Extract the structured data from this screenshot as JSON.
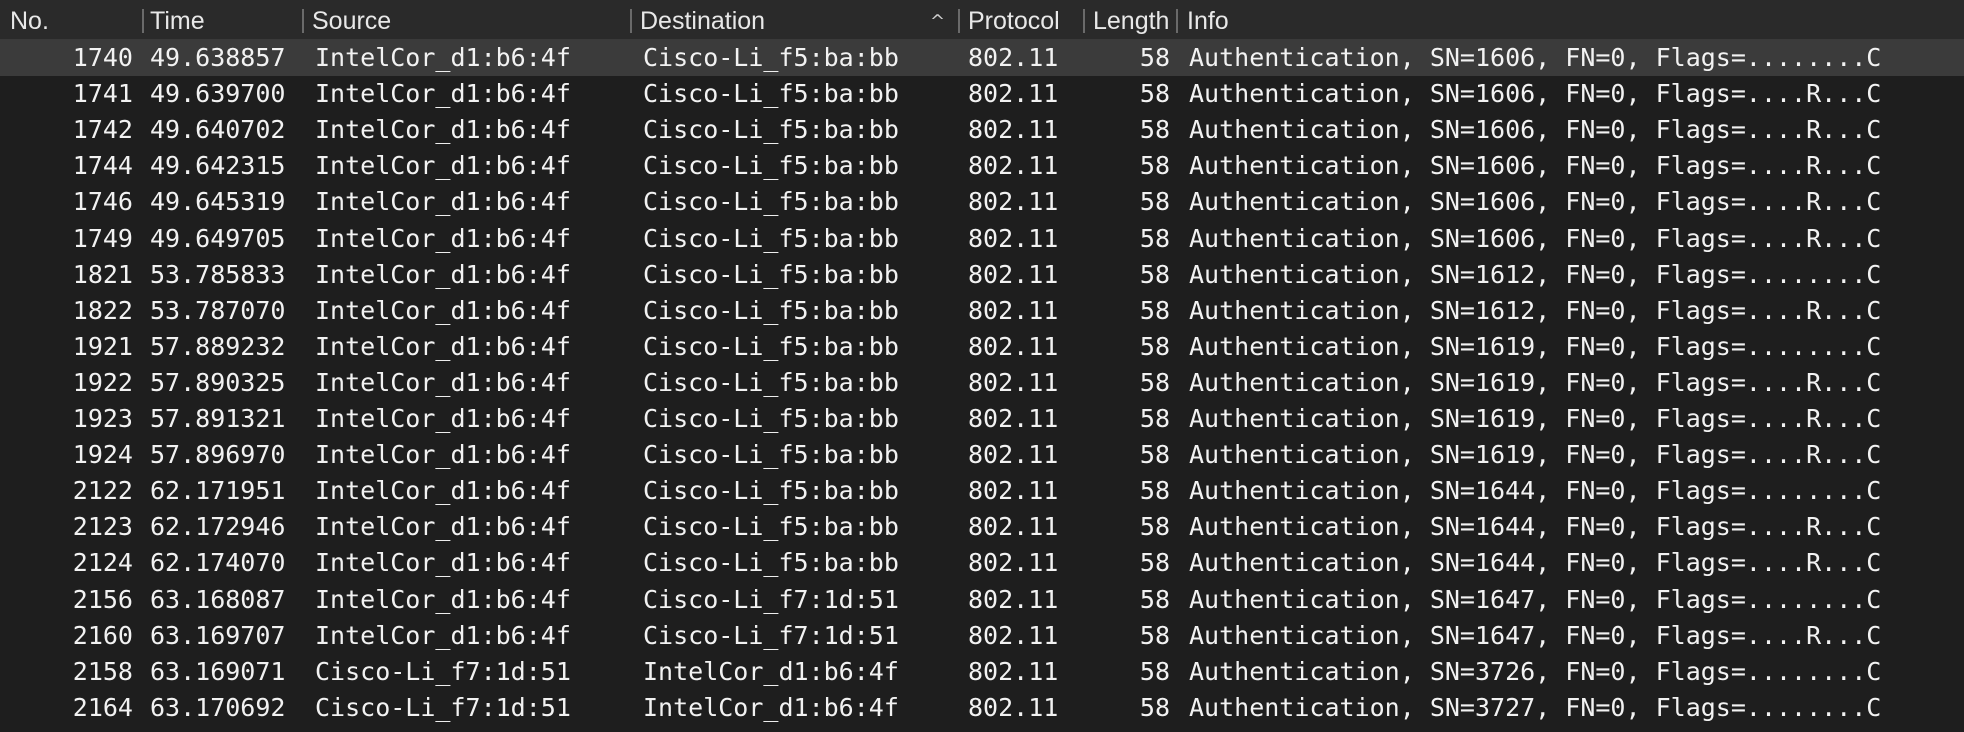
{
  "columns": {
    "no": "No.",
    "time": "Time",
    "source": "Source",
    "destination": "Destination",
    "protocol": "Protocol",
    "length": "Length",
    "info": "Info"
  },
  "sort_indicator": "^",
  "packets": [
    {
      "no": "1740",
      "time": "49.638857",
      "source": "IntelCor_d1:b6:4f",
      "destination": "Cisco-Li_f5:ba:bb",
      "protocol": "802.11",
      "length": "58",
      "info": "Authentication, SN=1606, FN=0, Flags=........C"
    },
    {
      "no": "1741",
      "time": "49.639700",
      "source": "IntelCor_d1:b6:4f",
      "destination": "Cisco-Li_f5:ba:bb",
      "protocol": "802.11",
      "length": "58",
      "info": "Authentication, SN=1606, FN=0, Flags=....R...C"
    },
    {
      "no": "1742",
      "time": "49.640702",
      "source": "IntelCor_d1:b6:4f",
      "destination": "Cisco-Li_f5:ba:bb",
      "protocol": "802.11",
      "length": "58",
      "info": "Authentication, SN=1606, FN=0, Flags=....R...C"
    },
    {
      "no": "1744",
      "time": "49.642315",
      "source": "IntelCor_d1:b6:4f",
      "destination": "Cisco-Li_f5:ba:bb",
      "protocol": "802.11",
      "length": "58",
      "info": "Authentication, SN=1606, FN=0, Flags=....R...C"
    },
    {
      "no": "1746",
      "time": "49.645319",
      "source": "IntelCor_d1:b6:4f",
      "destination": "Cisco-Li_f5:ba:bb",
      "protocol": "802.11",
      "length": "58",
      "info": "Authentication, SN=1606, FN=0, Flags=....R...C"
    },
    {
      "no": "1749",
      "time": "49.649705",
      "source": "IntelCor_d1:b6:4f",
      "destination": "Cisco-Li_f5:ba:bb",
      "protocol": "802.11",
      "length": "58",
      "info": "Authentication, SN=1606, FN=0, Flags=....R...C"
    },
    {
      "no": "1821",
      "time": "53.785833",
      "source": "IntelCor_d1:b6:4f",
      "destination": "Cisco-Li_f5:ba:bb",
      "protocol": "802.11",
      "length": "58",
      "info": "Authentication, SN=1612, FN=0, Flags=........C"
    },
    {
      "no": "1822",
      "time": "53.787070",
      "source": "IntelCor_d1:b6:4f",
      "destination": "Cisco-Li_f5:ba:bb",
      "protocol": "802.11",
      "length": "58",
      "info": "Authentication, SN=1612, FN=0, Flags=....R...C"
    },
    {
      "no": "1921",
      "time": "57.889232",
      "source": "IntelCor_d1:b6:4f",
      "destination": "Cisco-Li_f5:ba:bb",
      "protocol": "802.11",
      "length": "58",
      "info": "Authentication, SN=1619, FN=0, Flags=........C"
    },
    {
      "no": "1922",
      "time": "57.890325",
      "source": "IntelCor_d1:b6:4f",
      "destination": "Cisco-Li_f5:ba:bb",
      "protocol": "802.11",
      "length": "58",
      "info": "Authentication, SN=1619, FN=0, Flags=....R...C"
    },
    {
      "no": "1923",
      "time": "57.891321",
      "source": "IntelCor_d1:b6:4f",
      "destination": "Cisco-Li_f5:ba:bb",
      "protocol": "802.11",
      "length": "58",
      "info": "Authentication, SN=1619, FN=0, Flags=....R...C"
    },
    {
      "no": "1924",
      "time": "57.896970",
      "source": "IntelCor_d1:b6:4f",
      "destination": "Cisco-Li_f5:ba:bb",
      "protocol": "802.11",
      "length": "58",
      "info": "Authentication, SN=1619, FN=0, Flags=....R...C"
    },
    {
      "no": "2122",
      "time": "62.171951",
      "source": "IntelCor_d1:b6:4f",
      "destination": "Cisco-Li_f5:ba:bb",
      "protocol": "802.11",
      "length": "58",
      "info": "Authentication, SN=1644, FN=0, Flags=........C"
    },
    {
      "no": "2123",
      "time": "62.172946",
      "source": "IntelCor_d1:b6:4f",
      "destination": "Cisco-Li_f5:ba:bb",
      "protocol": "802.11",
      "length": "58",
      "info": "Authentication, SN=1644, FN=0, Flags=....R...C"
    },
    {
      "no": "2124",
      "time": "62.174070",
      "source": "IntelCor_d1:b6:4f",
      "destination": "Cisco-Li_f5:ba:bb",
      "protocol": "802.11",
      "length": "58",
      "info": "Authentication, SN=1644, FN=0, Flags=....R...C"
    },
    {
      "no": "2156",
      "time": "63.168087",
      "source": "IntelCor_d1:b6:4f",
      "destination": "Cisco-Li_f7:1d:51",
      "protocol": "802.11",
      "length": "58",
      "info": "Authentication, SN=1647, FN=0, Flags=........C"
    },
    {
      "no": "2160",
      "time": "63.169707",
      "source": "IntelCor_d1:b6:4f",
      "destination": "Cisco-Li_f7:1d:51",
      "protocol": "802.11",
      "length": "58",
      "info": "Authentication, SN=1647, FN=0, Flags=....R...C"
    },
    {
      "no": "2158",
      "time": "63.169071",
      "source": "Cisco-Li_f7:1d:51",
      "destination": "IntelCor_d1:b6:4f",
      "protocol": "802.11",
      "length": "58",
      "info": "Authentication, SN=3726, FN=0, Flags=........C"
    },
    {
      "no": "2164",
      "time": "63.170692",
      "source": "Cisco-Li_f7:1d:51",
      "destination": "IntelCor_d1:b6:4f",
      "protocol": "802.11",
      "length": "58",
      "info": "Authentication, SN=3727, FN=0, Flags=........C"
    }
  ]
}
